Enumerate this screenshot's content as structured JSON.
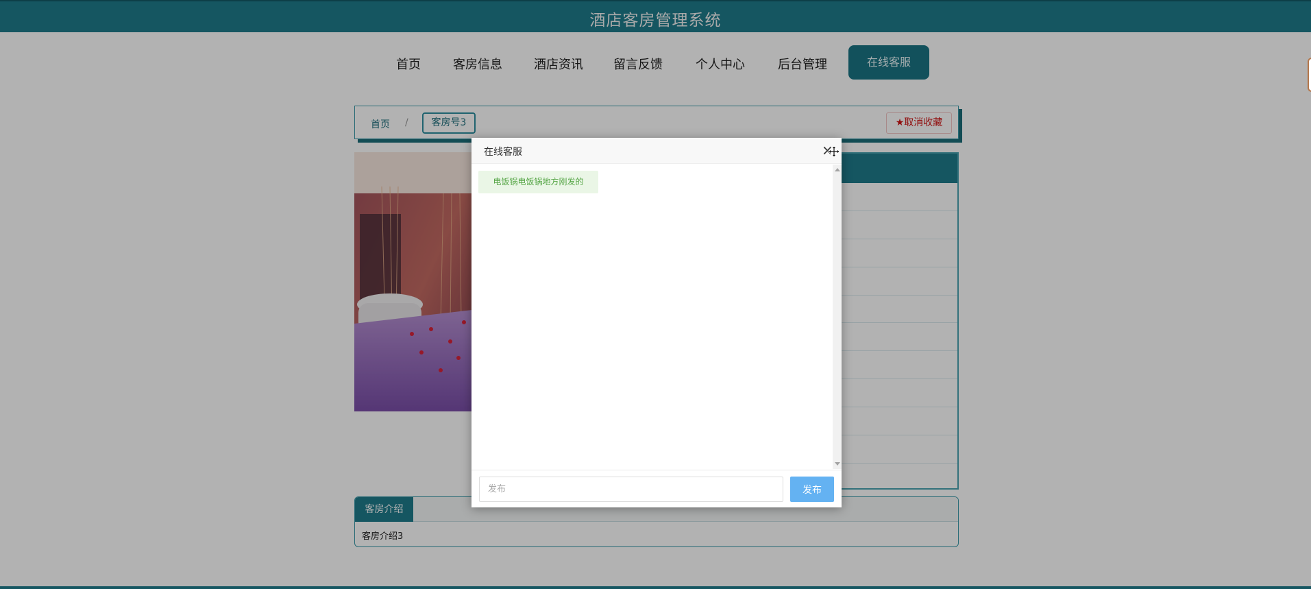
{
  "header": {
    "title": "酒店客房管理系统"
  },
  "nav": {
    "items": [
      {
        "label": "首页"
      },
      {
        "label": "客房信息"
      },
      {
        "label": "酒店资讯"
      },
      {
        "label": "留言反馈"
      },
      {
        "label": "个人中心"
      },
      {
        "label": "后台管理"
      }
    ],
    "cta_label": "在线客服"
  },
  "breadcrumb": {
    "home": "首页",
    "separator": "/",
    "current": "客房号3",
    "favorite_label": "取消收藏",
    "favorite_icon": "star-icon"
  },
  "tabs": {
    "active_label": "客房介绍",
    "content": "客房介绍3"
  },
  "dialog": {
    "title": "在线客服",
    "close_glyph": "×",
    "messages": [
      {
        "text": "电饭锅电饭锅地方刚发的"
      }
    ],
    "input_placeholder": "发布",
    "send_label": "发布"
  },
  "colors": {
    "brand": "#1f7c8c",
    "favorite": "#d01414",
    "send_button": "#64b2f2",
    "message_bubble": "#eaf6e6"
  }
}
